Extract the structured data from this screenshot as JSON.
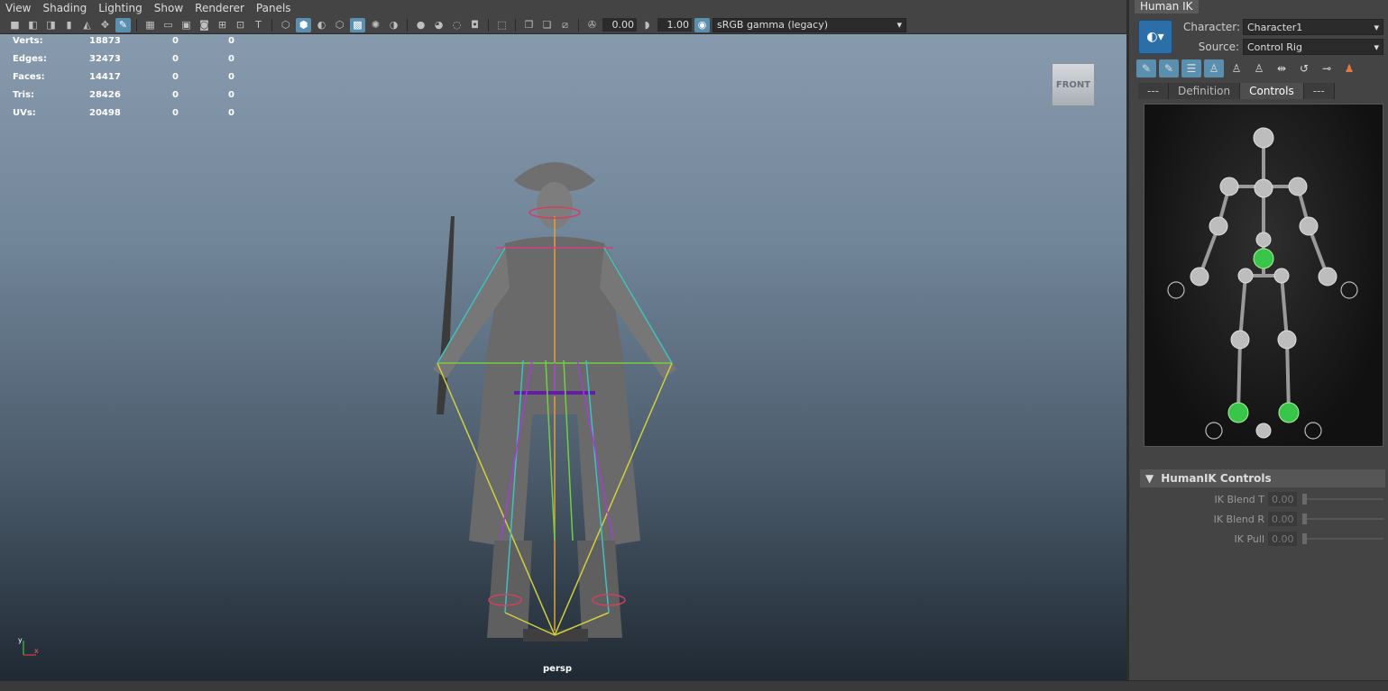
{
  "menubar": {
    "items": [
      "View",
      "Shading",
      "Lighting",
      "Show",
      "Renderer",
      "Panels"
    ]
  },
  "toolbar": {
    "exposure": "0.00",
    "gamma": "1.00",
    "colorspace": "sRGB gamma (legacy)"
  },
  "hud": {
    "rows": [
      {
        "label": "Verts:",
        "v1": "18873",
        "v2": "0",
        "v3": "0"
      },
      {
        "label": "Edges:",
        "v1": "32473",
        "v2": "0",
        "v3": "0"
      },
      {
        "label": "Faces:",
        "v1": "14417",
        "v2": "0",
        "v3": "0"
      },
      {
        "label": "Tris:",
        "v1": "28426",
        "v2": "0",
        "v3": "0"
      },
      {
        "label": "UVs:",
        "v1": "20498",
        "v2": "0",
        "v3": "0"
      }
    ]
  },
  "viewport": {
    "viewcube": "FRONT",
    "camera": "persp",
    "axis_y": "y",
    "axis_x": "x"
  },
  "hik": {
    "tab": "Human IK",
    "character_label": "Character:",
    "character_value": "Character1",
    "source_label": "Source:",
    "source_value": "Control Rig",
    "tabs": [
      "---",
      "Definition",
      "Controls",
      "---"
    ],
    "controls_header": "HumanIK Controls",
    "ik_rows": [
      {
        "label": "IK Blend T",
        "value": "0.00"
      },
      {
        "label": "IK Blend R",
        "value": "0.00"
      },
      {
        "label": "IK Pull",
        "value": "0.00"
      }
    ]
  },
  "colors": {
    "accent": "#5a8fb0",
    "effector_active": "#39c44a"
  }
}
